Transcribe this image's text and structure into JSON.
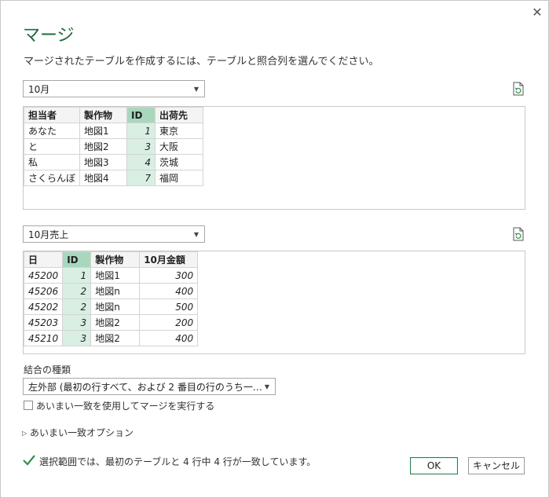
{
  "dialog": {
    "close_glyph": "✕",
    "title": "マージ",
    "subtitle": "マージされたテーブルを作成するには、テーブルと照合列を選んでください。"
  },
  "table1": {
    "selected": "10月",
    "columns": [
      "担当者",
      "製作物",
      "ID",
      "出荷先"
    ],
    "selected_column": "ID",
    "rows": [
      [
        "あなた",
        "地図1",
        "1",
        "東京"
      ],
      [
        "と",
        "地図2",
        "3",
        "大阪"
      ],
      [
        "私",
        "地図3",
        "4",
        "茨城"
      ],
      [
        "さくらんぼ",
        "地図4",
        "7",
        "福岡"
      ]
    ]
  },
  "table2": {
    "selected": "10月売上",
    "columns": [
      "日",
      "ID",
      "製作物",
      "10月金額"
    ],
    "selected_column": "ID",
    "rows": [
      [
        "45200",
        "1",
        "地図1",
        "300"
      ],
      [
        "45206",
        "2",
        "地図n",
        "400"
      ],
      [
        "45202",
        "2",
        "地図n",
        "500"
      ],
      [
        "45203",
        "3",
        "地図2",
        "200"
      ],
      [
        "45210",
        "3",
        "地図2",
        "400"
      ]
    ]
  },
  "join": {
    "label": "結合の種類",
    "selected": "左外部 (最初の行すべて、および 2 番目の行のうち一…"
  },
  "fuzzy": {
    "checkbox_label": "あいまい一致を使用してマージを実行する",
    "checked": false,
    "options_label": "あいまい一致オプション",
    "expander_glyph": "▷"
  },
  "status": {
    "text": "選択範囲では、最初のテーブルと 4 行中 4 行が一致しています。",
    "color": "#2f8f4e"
  },
  "buttons": {
    "ok": "OK",
    "cancel": "キャンセル"
  },
  "icons": {
    "close": "close-icon",
    "refresh": "refresh-icon",
    "caret": "chevron-down-icon",
    "check": "check-icon"
  },
  "colors": {
    "accent": "#1e6b3a",
    "selected_header": "#a9d7bd",
    "selected_cell": "#d9efe3"
  }
}
